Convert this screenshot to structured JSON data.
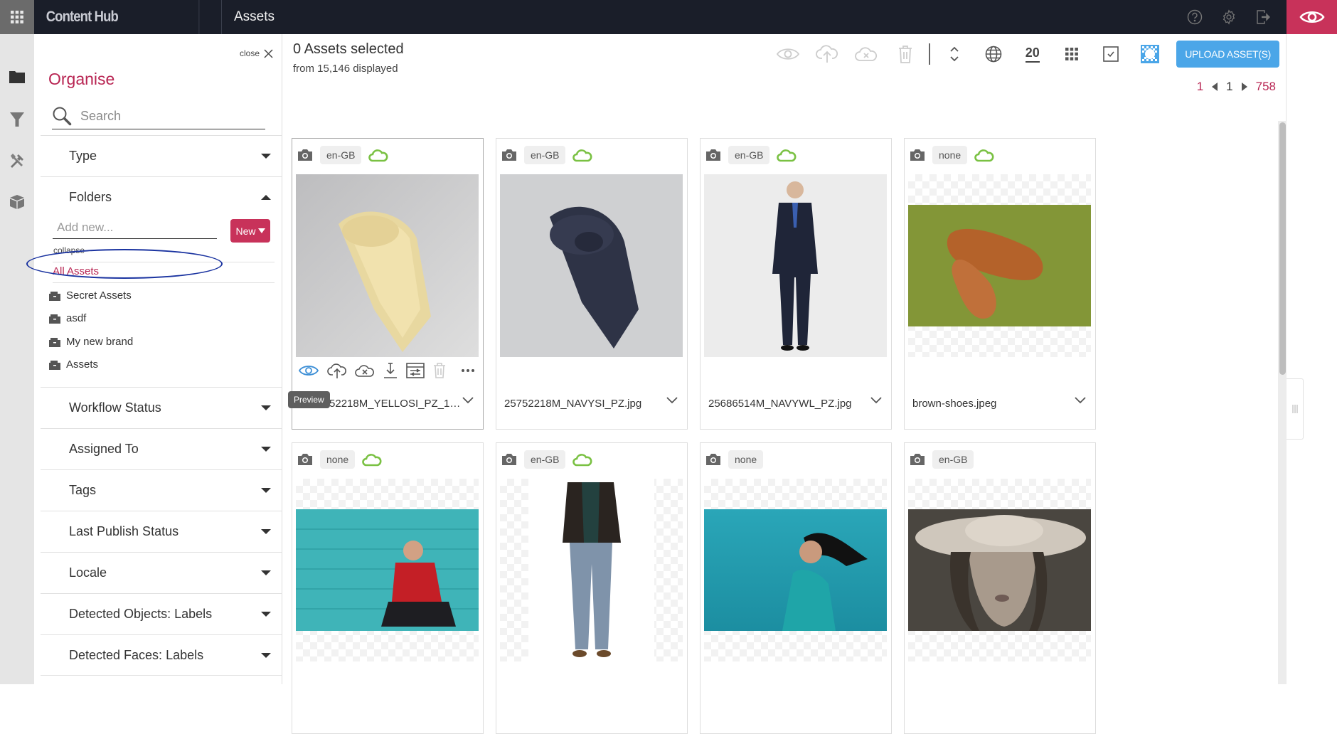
{
  "topbar": {
    "app_grid_icon": "app-grid-icon",
    "brand": "Content Hub",
    "page_title": "Assets",
    "icons": [
      "help-icon",
      "settings-icon",
      "logout-icon",
      "eye-icon"
    ],
    "accent_color": "#c8325a"
  },
  "rail": {
    "items": [
      "folder-icon",
      "filter-icon",
      "tools-icon",
      "box-icon"
    ]
  },
  "panel": {
    "close_label": "close",
    "title": "Organise",
    "search_placeholder": "Search",
    "facets_top": [
      {
        "label": "Type",
        "expanded": false
      },
      {
        "label": "Folders",
        "expanded": true
      }
    ],
    "folders": {
      "add_placeholder": "Add new...",
      "new_button": "New",
      "collapse_label": "collapse",
      "all_assets": "All Assets",
      "items": [
        "Secret Assets",
        "asdf",
        "My new brand",
        "Assets"
      ]
    },
    "facets_bottom": [
      {
        "label": "Workflow Status"
      },
      {
        "label": "Assigned To"
      },
      {
        "label": "Tags"
      },
      {
        "label": "Last Publish Status"
      },
      {
        "label": "Locale"
      },
      {
        "label": "Detected Objects: Labels"
      },
      {
        "label": "Detected Faces: Labels"
      }
    ]
  },
  "main": {
    "selection_title": "0 Assets selected",
    "selection_sub": "from 15,146 displayed",
    "toolbar": {
      "per_page": "20",
      "upload_label": "UPLOAD ASSET(S)",
      "upload_color": "#4ba6e8"
    },
    "pager": {
      "first": "1",
      "current": "1",
      "last": "758"
    },
    "tooltip": "Preview",
    "cards": [
      {
        "locale": "en-GB",
        "published": true,
        "name": "25752218M_YELLOSI_PZ_1....",
        "image": "yellow-tie"
      },
      {
        "locale": "en-GB",
        "published": true,
        "name": "25752218M_NAVYSI_PZ.jpg",
        "image": "navy-tie"
      },
      {
        "locale": "en-GB",
        "published": true,
        "name": "25686514M_NAVYWL_PZ.jpg",
        "image": "man-in-suit"
      },
      {
        "locale": "none",
        "published": true,
        "name": "brown-shoes.jpeg",
        "image": "brown-shoes"
      },
      {
        "locale": "none",
        "published": true,
        "name": "",
        "image": "man-red-sweater"
      },
      {
        "locale": "en-GB",
        "published": true,
        "name": "",
        "image": "man-jacket-jeans"
      },
      {
        "locale": "none",
        "published": false,
        "name": "",
        "image": "woman-teal-jacket"
      },
      {
        "locale": "en-GB",
        "published": false,
        "name": "",
        "image": "woman-hat"
      }
    ]
  }
}
